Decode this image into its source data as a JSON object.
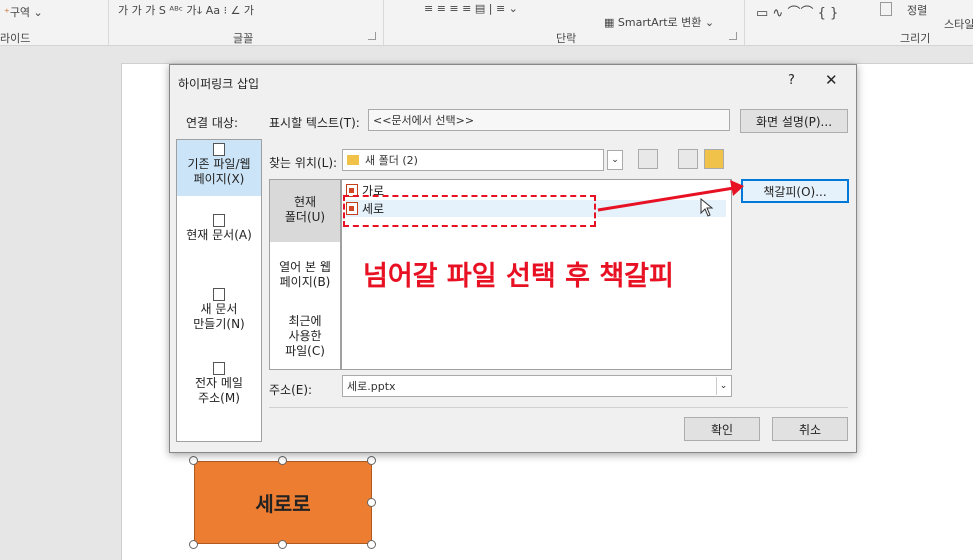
{
  "ribbon": {
    "section_label": "구역",
    "left_label": "라이드",
    "groups": [
      "글꼴",
      "단락",
      "그리기"
    ],
    "font_tools": "가  가  가  S  ᴬᴮᶜ  가ↆ  Aa  ⁝  ∠  가",
    "smartart": "SmartArt로 변환",
    "arrange": "정렬",
    "style": "스타일"
  },
  "dialog": {
    "title": "하이퍼링크 삽입",
    "help": "?",
    "close": "✕",
    "link_to_label": "연결 대상:",
    "link_to_items": [
      {
        "line1": "기존 파일/웹",
        "line2": "페이지(X)"
      },
      {
        "line1": "현재 문서(A)",
        "line2": ""
      },
      {
        "line1": "새 문서",
        "line2": "만들기(N)"
      },
      {
        "line1": "전자 메일",
        "line2": "주소(M)"
      }
    ],
    "display_text_label": "표시할 텍스트(T):",
    "display_text_value": "<<문서에서 선택>>",
    "screentip_button": "화면 설명(P)...",
    "look_in_label": "찾는 위치(L):",
    "look_in_value": "새 폴더 (2)",
    "side_items": [
      {
        "line1": "현재",
        "line2": "폴더(U)"
      },
      {
        "line1": "열어 본 웹",
        "line2": "페이지(B)"
      },
      {
        "line1": "최근에",
        "line2": "사용한",
        "line3": "파일(C)"
      }
    ],
    "files": [
      "가로",
      "세로"
    ],
    "bookmark_button": "책갈피(O)...",
    "address_label": "주소(E):",
    "address_value": "세로.pptx",
    "ok_button": "확인",
    "cancel_button": "취소"
  },
  "annotation": {
    "text": "넘어갈 파일 선택 후 책갈피",
    "color": "#e81123"
  },
  "slide": {
    "shape_text": "세로로",
    "shape_color": "#ed7d31"
  }
}
